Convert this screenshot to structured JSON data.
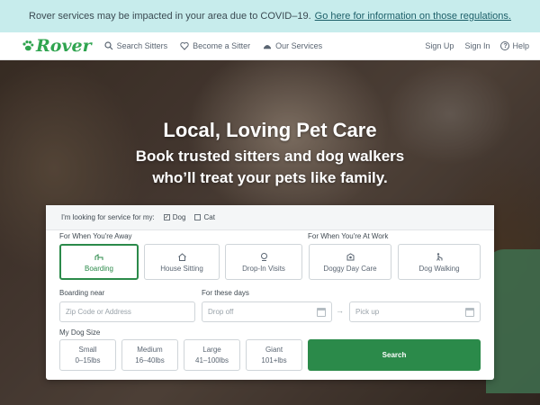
{
  "banner": {
    "text": "Rover services may be impacted in your area due to COVID–19.",
    "link": "Go here for information on those regulations."
  },
  "nav": {
    "logo": "Rover",
    "left_items": [
      {
        "label": "Search Sitters",
        "icon": "search-icon"
      },
      {
        "label": "Become a Sitter",
        "icon": "heart-icon"
      },
      {
        "label": "Our Services",
        "icon": "services-icon"
      }
    ],
    "sign_up": "Sign Up",
    "sign_in": "Sign In",
    "help": "Help"
  },
  "hero": {
    "title": "Local, Loving Pet Care",
    "subtitle_line1": "Book trusted sitters and dog walkers",
    "subtitle_line2": "who’ll treat your pets like family."
  },
  "search_form": {
    "looking_for": "I'm looking for service for my:",
    "pets": [
      {
        "label": "Dog",
        "checked": true
      },
      {
        "label": "Cat",
        "checked": false
      }
    ],
    "away_heading": "For When You're Away",
    "work_heading": "For When You're At Work",
    "services": [
      {
        "label": "Boarding",
        "icon": "boarding-icon",
        "selected": true
      },
      {
        "label": "House Sitting",
        "icon": "house-sitting-icon",
        "selected": false
      },
      {
        "label": "Drop-In Visits",
        "icon": "drop-in-icon",
        "selected": false
      },
      {
        "label": "Doggy Day Care",
        "icon": "day-care-icon",
        "selected": false
      },
      {
        "label": "Dog Walking",
        "icon": "dog-walking-icon",
        "selected": false
      }
    ],
    "location_label": "Boarding near",
    "location_placeholder": "Zip Code or Address",
    "dates_label": "For these days",
    "dropoff_placeholder": "Drop off",
    "pickup_placeholder": "Pick up",
    "size_label": "My Dog Size",
    "sizes": [
      {
        "label": "Small",
        "range": "0–15lbs"
      },
      {
        "label": "Medium",
        "range": "16–40lbs"
      },
      {
        "label": "Large",
        "range": "41–100lbs"
      },
      {
        "label": "Giant",
        "range": "101+lbs"
      }
    ],
    "search_label": "Search"
  },
  "colors": {
    "brand_green": "#2b8a4a",
    "banner_bg": "#c7ecec"
  }
}
